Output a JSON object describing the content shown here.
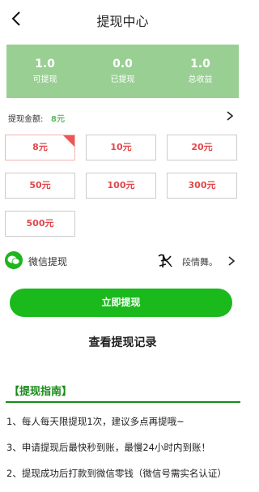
{
  "header": {
    "title": "提现中心"
  },
  "stats": [
    {
      "value": "1.0",
      "label": "可提现"
    },
    {
      "value": "0.0",
      "label": "已提现"
    },
    {
      "value": "1.0",
      "label": "总收益"
    }
  ],
  "amount": {
    "label": "提现金额:",
    "value": "8元"
  },
  "options": [
    "8元",
    "10元",
    "20元",
    "50元",
    "100元",
    "300元",
    "500元"
  ],
  "selected_option": "8元",
  "payout": {
    "method_label": "微信提现",
    "nickname": "段情舞。"
  },
  "buttons": {
    "withdraw": "立即提现",
    "records": "查看提现记录"
  },
  "guide": {
    "title": "【提现指南】",
    "items": [
      "1、每人每天限提现1次，建议多点再提哦~",
      "3、申请提现后最快秒到账，最慢24小时内到账！",
      "2、提现成功后打款到微信零钱（微信号需实名认证）"
    ]
  },
  "colors": {
    "accent": "#1ab91c",
    "stats_bg": "#99cf93",
    "amount_text": "#e0484b",
    "guide_green": "#1a8a1a"
  }
}
